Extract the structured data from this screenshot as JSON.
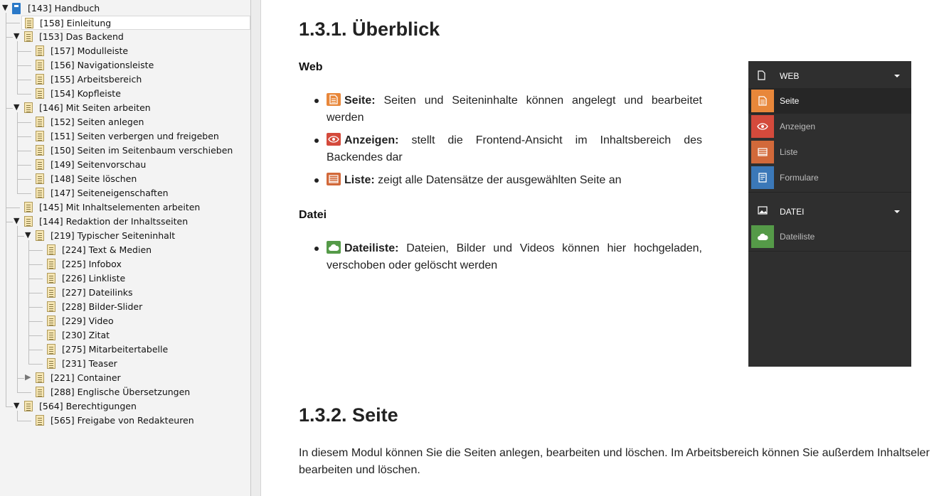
{
  "tree": {
    "items": [
      {
        "id": "143",
        "label": "[143] Handbuch",
        "indent": 0,
        "toggle": "open",
        "icon": "book"
      },
      {
        "id": "158",
        "label": "[158] Einleitung",
        "indent": 1,
        "toggle": "none",
        "icon": "page",
        "selected": true
      },
      {
        "id": "153",
        "label": "[153] Das Backend",
        "indent": 1,
        "toggle": "open",
        "icon": "page"
      },
      {
        "id": "157",
        "label": "[157] Modulleiste",
        "indent": 2,
        "toggle": "none",
        "icon": "page"
      },
      {
        "id": "156",
        "label": "[156] Navigationsleiste",
        "indent": 2,
        "toggle": "none",
        "icon": "page"
      },
      {
        "id": "155",
        "label": "[155] Arbeitsbereich",
        "indent": 2,
        "toggle": "none",
        "icon": "page"
      },
      {
        "id": "154",
        "label": "[154] Kopfleiste",
        "indent": 2,
        "toggle": "none",
        "icon": "page"
      },
      {
        "id": "146",
        "label": "[146] Mit Seiten arbeiten",
        "indent": 1,
        "toggle": "open",
        "icon": "page"
      },
      {
        "id": "152",
        "label": "[152] Seiten anlegen",
        "indent": 2,
        "toggle": "none",
        "icon": "page"
      },
      {
        "id": "151",
        "label": "[151] Seiten verbergen und freigeben",
        "indent": 2,
        "toggle": "none",
        "icon": "page"
      },
      {
        "id": "150",
        "label": "[150] Seiten im Seitenbaum verschieben",
        "indent": 2,
        "toggle": "none",
        "icon": "page"
      },
      {
        "id": "149",
        "label": "[149] Seitenvorschau",
        "indent": 2,
        "toggle": "none",
        "icon": "page"
      },
      {
        "id": "148",
        "label": "[148] Seite löschen",
        "indent": 2,
        "toggle": "none",
        "icon": "page"
      },
      {
        "id": "147",
        "label": "[147] Seiteneigenschaften",
        "indent": 2,
        "toggle": "none",
        "icon": "page"
      },
      {
        "id": "145",
        "label": "[145] Mit Inhaltselementen arbeiten",
        "indent": 1,
        "toggle": "none",
        "icon": "page"
      },
      {
        "id": "144",
        "label": "[144] Redaktion der Inhaltsseiten",
        "indent": 1,
        "toggle": "open",
        "icon": "page"
      },
      {
        "id": "219",
        "label": "[219] Typischer Seiteninhalt",
        "indent": 2,
        "toggle": "open",
        "icon": "page"
      },
      {
        "id": "224",
        "label": "[224] Text & Medien",
        "indent": 3,
        "toggle": "none",
        "icon": "page"
      },
      {
        "id": "225",
        "label": "[225] Infobox",
        "indent": 3,
        "toggle": "none",
        "icon": "page"
      },
      {
        "id": "226",
        "label": "[226] Linkliste",
        "indent": 3,
        "toggle": "none",
        "icon": "page"
      },
      {
        "id": "227",
        "label": "[227] Dateilinks",
        "indent": 3,
        "toggle": "none",
        "icon": "page"
      },
      {
        "id": "228",
        "label": "[228] Bilder-Slider",
        "indent": 3,
        "toggle": "none",
        "icon": "page"
      },
      {
        "id": "229",
        "label": "[229] Video",
        "indent": 3,
        "toggle": "none",
        "icon": "page"
      },
      {
        "id": "230",
        "label": "[230] Zitat",
        "indent": 3,
        "toggle": "none",
        "icon": "page"
      },
      {
        "id": "275",
        "label": "[275] Mitarbeitertabelle",
        "indent": 3,
        "toggle": "none",
        "icon": "page"
      },
      {
        "id": "231",
        "label": "[231] Teaser",
        "indent": 3,
        "toggle": "none",
        "icon": "page"
      },
      {
        "id": "221",
        "label": "[221] Container",
        "indent": 2,
        "toggle": "closed",
        "icon": "page"
      },
      {
        "id": "288",
        "label": "[288] Englische Übersetzungen",
        "indent": 2,
        "toggle": "none",
        "icon": "page"
      },
      {
        "id": "564",
        "label": "[564] Berechtigungen",
        "indent": 1,
        "toggle": "open",
        "icon": "page"
      },
      {
        "id": "565",
        "label": "[565] Freigabe von Redakteuren",
        "indent": 2,
        "toggle": "none",
        "icon": "page"
      }
    ]
  },
  "content": {
    "section1": {
      "title": "1.3.1. Überblick",
      "web_heading": "Web",
      "web_items": [
        {
          "name": "Seite:",
          "text": "Seiten und Seiteninhalte können angelegt und bearbeitet werden",
          "icon": "page-icon",
          "color": "#e8873a"
        },
        {
          "name": "Anzeigen:",
          "text": "stellt die Frontend-Ansicht im Inhaltsbereich des Backendes dar",
          "icon": "eye-icon",
          "color": "#d44a3c"
        },
        {
          "name": "Liste:",
          "text": "zeigt alle Datensätze der ausgewählten Seite an",
          "icon": "list-icon",
          "color": "#d2693a"
        }
      ],
      "file_heading": "Datei",
      "file_items": [
        {
          "name": "Dateiliste:",
          "text": "Dateien, Bilder und Videos können hier hochgeladen, verschoben oder gelöscht werden",
          "icon": "cloud-icon",
          "color": "#559a48"
        }
      ]
    },
    "section2": {
      "title": "1.3.2. Seite",
      "paragraph": "In diesem Modul können Sie die Seiten anlegen, bearbeiten und löschen. Im Arbeitsbereich können Sie außerdem Inhaltseler bearbeiten und löschen."
    }
  },
  "module_panel": {
    "groups": [
      {
        "header": "WEB",
        "header_icon": "document-icon",
        "items": [
          {
            "label": "Seite",
            "icon": "page-icon",
            "color": "#e8873a",
            "active": true
          },
          {
            "label": "Anzeigen",
            "icon": "eye-icon",
            "color": "#d44a3c"
          },
          {
            "label": "Liste",
            "icon": "list-icon",
            "color": "#d2693a"
          },
          {
            "label": "Formulare",
            "icon": "form-icon",
            "color": "#3b78b8"
          }
        ]
      },
      {
        "header": "DATEI",
        "header_icon": "image-icon",
        "items": [
          {
            "label": "Dateiliste",
            "icon": "cloud-icon",
            "color": "#559a48"
          }
        ]
      }
    ]
  }
}
